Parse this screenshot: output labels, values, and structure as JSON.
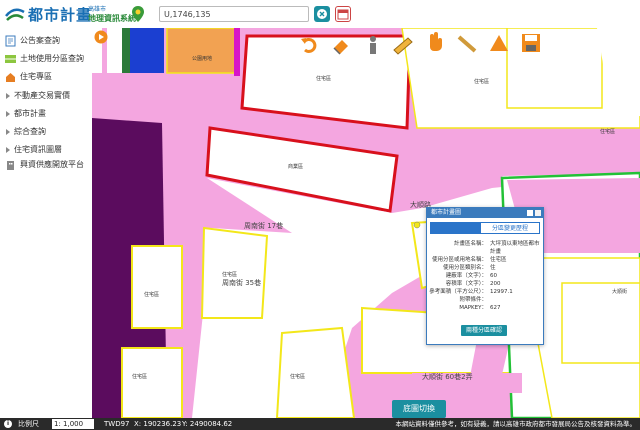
{
  "header": {
    "logo_main": "都市計畫",
    "logo_sub1": "高雄市",
    "logo_sub2": "地理資訊系統",
    "search_value": "U,1746,135"
  },
  "sidebar": {
    "items": [
      {
        "label": "公告案查詢",
        "icon": "document-icon",
        "kind": "icon"
      },
      {
        "label": "土地使用分區查詢",
        "icon": "land-icon",
        "kind": "icon"
      },
      {
        "label": "住宅專區",
        "icon": "house-icon",
        "kind": "icon"
      },
      {
        "label": "不動產交易實價",
        "kind": "arrow"
      },
      {
        "label": "都市計畫",
        "kind": "arrow"
      },
      {
        "label": "綜合查詢",
        "kind": "arrow"
      },
      {
        "label": "住宅資訊圖層",
        "kind": "arrow"
      },
      {
        "label": "興資供應開放平台",
        "icon": "building-icon",
        "kind": "icon"
      }
    ]
  },
  "map": {
    "labels": {
      "park": "公園用地",
      "lot1": "住宅區",
      "lot2": "商業區",
      "lot3": "住宅區",
      "lot4": "住宅區",
      "lot5": "住宅區",
      "lot6": "住宅區",
      "lot7": "住宅區",
      "lot8": "住宅區",
      "road1": "周南街 17巷",
      "road2": "周南街 35巷",
      "road3": "大順路",
      "road4": "大順街 60巷2弄",
      "road5": "大順街"
    }
  },
  "popup": {
    "title": "都市計畫圖",
    "tab1": "",
    "tab2": "分區變更歷程",
    "rows": [
      {
        "k": "計畫區名稱：",
        "v": "大坪頂以東地區都市計畫"
      },
      {
        "k": "使用分區或用地名稱：",
        "v": "住宅區"
      },
      {
        "k": "使用分區類別名：",
        "v": "住"
      },
      {
        "k": "建蔽率（文字）：",
        "v": "60"
      },
      {
        "k": "容積率（文字）：",
        "v": "200"
      },
      {
        "k": "參考面積（平方公尺）：",
        "v": "12997.1"
      },
      {
        "k": "附帶條件：",
        "v": ""
      },
      {
        "k": "MAPKEY：",
        "v": "627"
      }
    ],
    "button": "兩種分區確認"
  },
  "switch_button": "底圖切換",
  "status": {
    "info": "i",
    "scale_label": "比例尺",
    "scale_value": "1: 1,000",
    "coord_sys": "TWD97",
    "x": "X: 190236.23",
    "y": "Y: 2490084.62",
    "note": "本網站資料僅供參考，如有疑義，請以高雄市政府都市發展局公告及核發資料為準。"
  },
  "colors": {
    "pink_zone": "#f4a6e0",
    "red_outline": "#d8101c",
    "yellow_outline": "#f3e71a",
    "purple": "#5b0c5e",
    "orange": "#f2a252",
    "teal": "#1b8fa0",
    "blue_popup": "#3b7bbd"
  }
}
